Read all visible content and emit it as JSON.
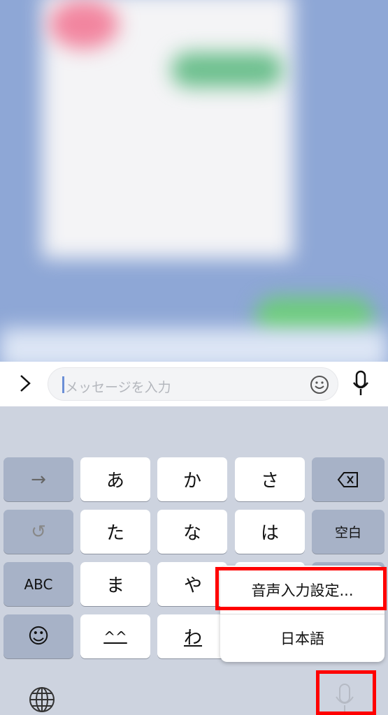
{
  "input": {
    "placeholder": "メッセージを入力"
  },
  "keyboard": {
    "rows": [
      [
        "→",
        "あ",
        "か",
        "さ",
        "⌫"
      ],
      [
        "↺",
        "た",
        "な",
        "は",
        "空白"
      ],
      [
        "ABC",
        "ま",
        "や",
        "",
        ""
      ],
      [
        "☺",
        "^^",
        "わ",
        "",
        ""
      ]
    ]
  },
  "popup": {
    "items": [
      "音声入力設定...",
      "日本語"
    ]
  },
  "colors": {
    "highlight": "#ff0000",
    "chat_bg": "#8ea7d6",
    "keyboard_bg": "#cdd3df"
  }
}
